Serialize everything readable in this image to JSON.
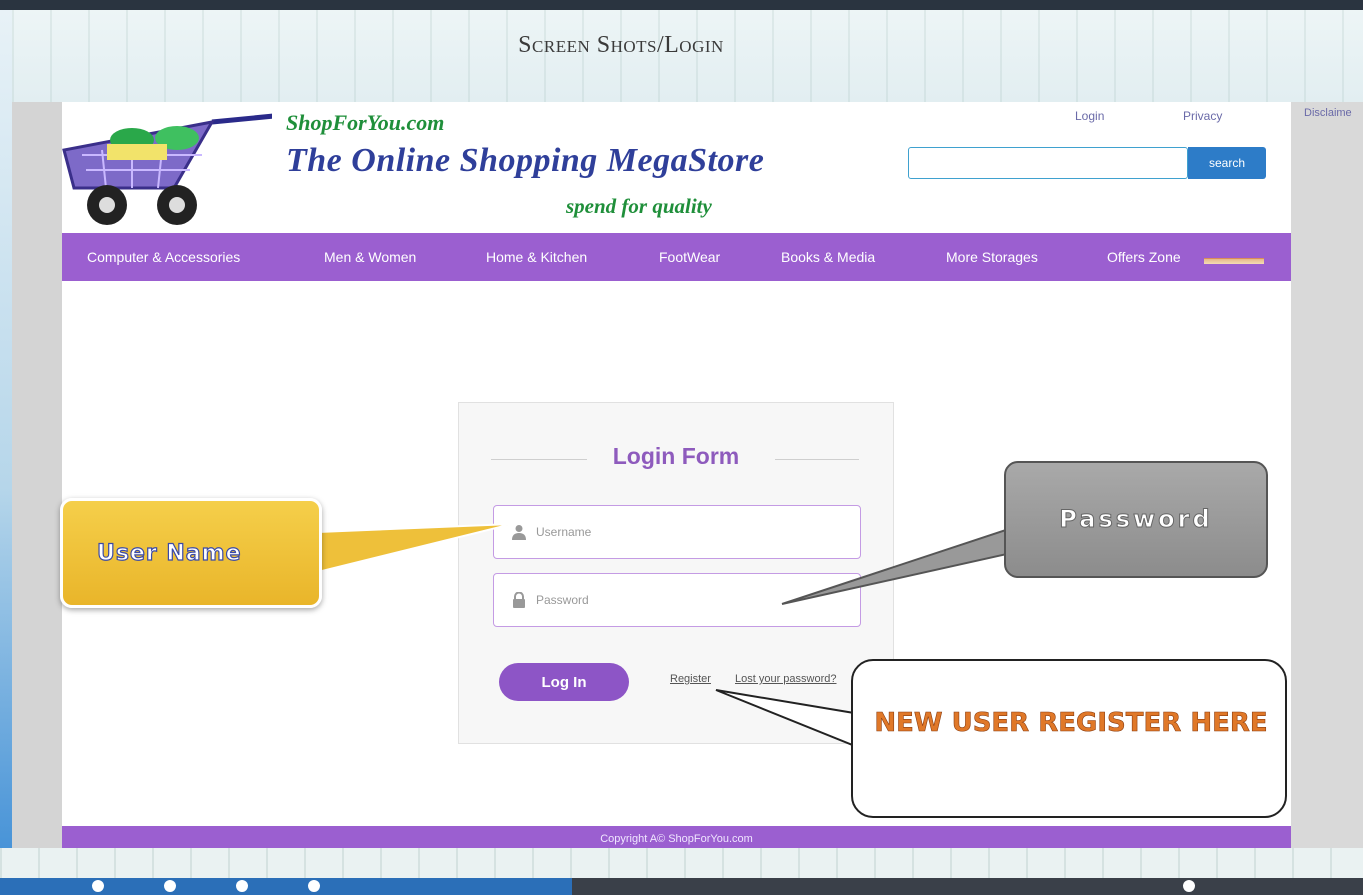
{
  "slide": {
    "title": "Screen Shots/Login"
  },
  "site": {
    "brand": "ShopForYou.com",
    "tagline": "The Online Shopping MegaStore",
    "subtagline": "spend for quality",
    "top_links": [
      "Login",
      "Privacy",
      "Disclaime"
    ],
    "search": {
      "value": "",
      "button_label": "search"
    },
    "nav": [
      "Computer & Accessories",
      "Men & Women",
      "Home & Kitchen",
      "FootWear",
      "Books & Media",
      "More Storages",
      "Offers Zone"
    ],
    "login_form": {
      "title": "Login Form",
      "username_placeholder": "Username",
      "password_placeholder": "Password",
      "login_button": "Log In",
      "register_link": "Register",
      "lost_password_link": "Lost your password?"
    },
    "footer": {
      "copyright": "Copyright A© ShopForYou.com"
    }
  },
  "callouts": {
    "user_name": "User Name",
    "password": "Password",
    "register": "NEW USER REGISTER HERE"
  },
  "colors": {
    "accent_purple": "#9b5fd0",
    "brand_green": "#1f8f3a",
    "tagline_blue": "#2f3f9a",
    "callout_yellow": "#f0c43a",
    "callout_orange_text": "#e07828"
  }
}
